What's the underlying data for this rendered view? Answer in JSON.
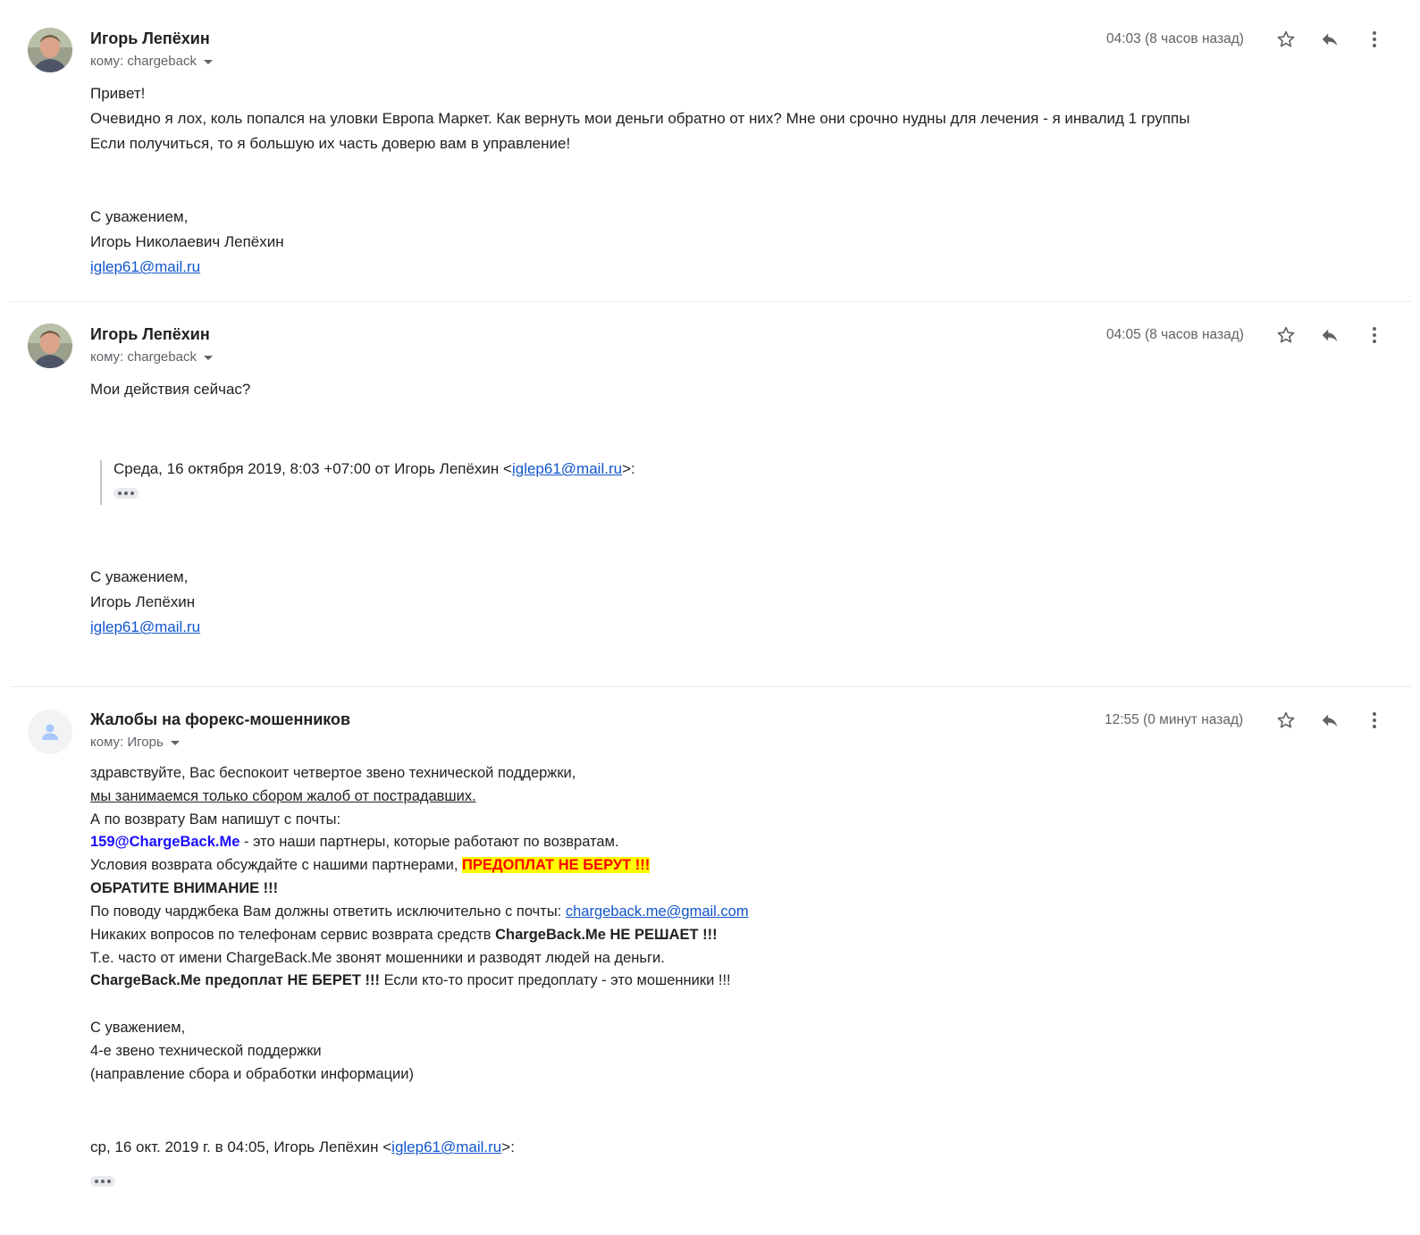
{
  "messages": [
    {
      "sender": "Игорь Лепёхин",
      "recipient": "кому: chargeback",
      "time": "04:03 (8 часов назад)",
      "body": [
        "Привет!",
        "Очевидно я лох, коль попался на уловки Европа Маркет. Как вернуть мои деньги обратно от них? Мне они срочно нудны для лечения - я инвалид 1 группы",
        "Если получиться, то я большую их часть доверю вам в управление!"
      ],
      "signature": [
        "С уважением,",
        "Игорь Николаевич Лепёхин"
      ],
      "email": "iglep61@mail.ru"
    },
    {
      "sender": "Игорь Лепёхин",
      "recipient": "кому: chargeback",
      "time": "04:05 (8 часов назад)",
      "body": [
        "Мои действия сейчас?"
      ],
      "quote_prefix": "Среда, 16 октября 2019, 8:03 +07:00 от Игорь Лепёхин <",
      "quote_email": "iglep61@mail.ru",
      "quote_suffix": ">:",
      "signature": [
        "С уважением,",
        "Игорь Лепёхин"
      ],
      "email": "iglep61@mail.ru"
    },
    {
      "sender": "Жалобы на форекс-мошенников",
      "recipient": "кому: Игорь",
      "time": "12:55 (0 минут назад)",
      "l1": "здравствуйте, Вас беспокоит четвертое звено технической поддержки,",
      "l2": "мы занимаемся только сбором жалоб от пострадавших.",
      "l3": "А по возврату Вам напишут с почты:",
      "l4_email": "159@ChargeBack.Me",
      "l4_rest": " - это наши партнеры, которые работают по возвратам.",
      "l5_text": "Условия возврата обсуждайте с нашими партнерами, ",
      "l5_highlight": "ПРЕДОПЛАТ НЕ БЕРУТ !!!",
      "l6": "ОБРАТИТЕ ВНИМАНИЕ !!!",
      "l7_text": "По поводу чарджбека Вам должны ответить исключительно с почты: ",
      "l7_email": "chargeback.me@gmail.com",
      "l8_text": "Никаких вопросов по телефонам сервис возврата средств ",
      "l8_bold": "ChargeBack.Me НЕ РЕШАЕТ !!!",
      "l9": "Т.е. часто от имени ChargeBack.Me звонят мошенники и разводят людей на деньги.",
      "l10_bold": "ChargeBack.Me предоплат НЕ БЕРЕТ !!!",
      "l10_rest": " Если кто-то просит предоплату - это мошенники !!!",
      "signature": [
        "С уважением,",
        "4-е звено технической поддержки",
        "(направление сбора и обработки информации)"
      ],
      "quote_prefix": "ср, 16 окт. 2019 г. в 04:05, Игорь Лепёхин <",
      "quote_email": "iglep61@mail.ru",
      "quote_suffix": ">:"
    }
  ],
  "icons": {
    "star": "star-icon",
    "reply": "reply-icon",
    "more": "more-vert-icon",
    "avatar_default": "person-icon"
  },
  "colors": {
    "link": "#1155cc",
    "highlight_bg": "#ffff00",
    "highlight_text": "#ff0000",
    "partner_email": "#1a0dff"
  }
}
